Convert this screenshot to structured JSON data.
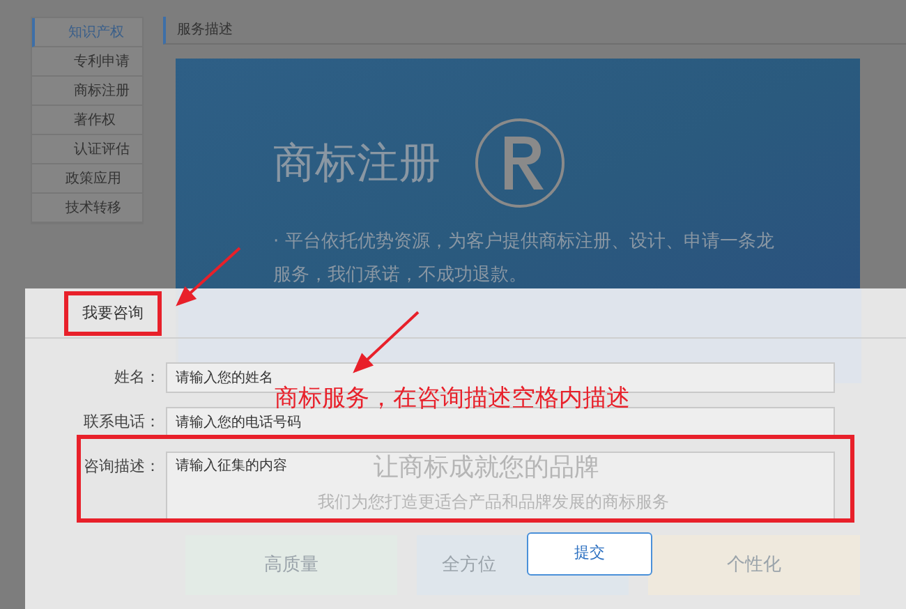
{
  "sidebar": {
    "items": [
      {
        "label": "知识产权",
        "selected": true,
        "children": [
          {
            "label": "专利申请",
            "selected": false
          },
          {
            "label": "商标注册",
            "selected": false
          },
          {
            "label": "著作权",
            "selected": false
          },
          {
            "label": "认证评估",
            "selected": false
          }
        ]
      },
      {
        "label": "政策应用",
        "selected": false
      },
      {
        "label": "技术转移",
        "selected": false
      }
    ]
  },
  "content": {
    "header": "服务描述",
    "banner": {
      "title": "商标注册",
      "text": "· 平台依托优势资源，为客户提供商标注册、设计、申请一条龙服务，我们承诺，不成功退款。"
    },
    "slogan": "让商标成就您的品牌",
    "subtitle": "我们为您打造更适合产品和品牌发展的商标服务",
    "cards": [
      "高质量",
      "全方位",
      "个性化"
    ]
  },
  "dialog": {
    "title": "我要咨询",
    "fields": [
      {
        "label": "姓名：",
        "placeholder": "请输入您的姓名",
        "kind": "input"
      },
      {
        "label": "联系电话：",
        "placeholder": "请输入您的电话号码",
        "kind": "input"
      },
      {
        "label": "咨询描述：",
        "placeholder": "请输入征集的内容",
        "kind": "textarea"
      }
    ],
    "submit": "提交"
  },
  "annotation": {
    "text": "商标服务，在咨询描述空格内描述"
  }
}
